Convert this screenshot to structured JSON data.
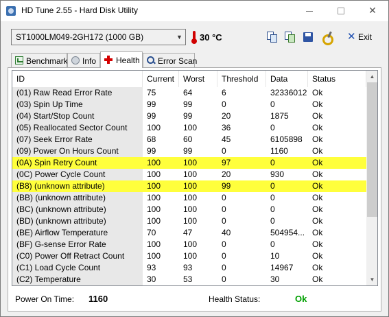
{
  "window": {
    "title": "HD Tune 2.55 - Hard Disk Utility"
  },
  "toolbar": {
    "drive": "ST1000LM049-2GH172 (1000 GB)",
    "temperature": "30 °C",
    "exit_label": "Exit"
  },
  "tabs": [
    {
      "label": "Benchmark",
      "icon": "benchmark-icon"
    },
    {
      "label": "Info",
      "icon": "info-icon"
    },
    {
      "label": "Health",
      "icon": "health-cross-icon",
      "selected": true
    },
    {
      "label": "Error Scan",
      "icon": "error-scan-icon"
    }
  ],
  "table": {
    "columns": [
      "ID",
      "Current",
      "Worst",
      "Threshold",
      "Data",
      "Status"
    ],
    "rows": [
      {
        "id": "(01) Raw Read Error Rate",
        "current": "75",
        "worst": "64",
        "threshold": "6",
        "data": "32336012",
        "status": "Ok",
        "highlight": false
      },
      {
        "id": "(03) Spin Up Time",
        "current": "99",
        "worst": "99",
        "threshold": "0",
        "data": "0",
        "status": "Ok",
        "highlight": false
      },
      {
        "id": "(04) Start/Stop Count",
        "current": "99",
        "worst": "99",
        "threshold": "20",
        "data": "1875",
        "status": "Ok",
        "highlight": false
      },
      {
        "id": "(05) Reallocated Sector Count",
        "current": "100",
        "worst": "100",
        "threshold": "36",
        "data": "0",
        "status": "Ok",
        "highlight": false
      },
      {
        "id": "(07) Seek Error Rate",
        "current": "68",
        "worst": "60",
        "threshold": "45",
        "data": "6105898",
        "status": "Ok",
        "highlight": false
      },
      {
        "id": "(09) Power On Hours Count",
        "current": "99",
        "worst": "99",
        "threshold": "0",
        "data": "1160",
        "status": "Ok",
        "highlight": false
      },
      {
        "id": "(0A) Spin Retry Count",
        "current": "100",
        "worst": "100",
        "threshold": "97",
        "data": "0",
        "status": "Ok",
        "highlight": true
      },
      {
        "id": "(0C) Power Cycle Count",
        "current": "100",
        "worst": "100",
        "threshold": "20",
        "data": "930",
        "status": "Ok",
        "highlight": false
      },
      {
        "id": "(B8) (unknown attribute)",
        "current": "100",
        "worst": "100",
        "threshold": "99",
        "data": "0",
        "status": "Ok",
        "highlight": true
      },
      {
        "id": "(BB) (unknown attribute)",
        "current": "100",
        "worst": "100",
        "threshold": "0",
        "data": "0",
        "status": "Ok",
        "highlight": false
      },
      {
        "id": "(BC) (unknown attribute)",
        "current": "100",
        "worst": "100",
        "threshold": "0",
        "data": "0",
        "status": "Ok",
        "highlight": false
      },
      {
        "id": "(BD) (unknown attribute)",
        "current": "100",
        "worst": "100",
        "threshold": "0",
        "data": "0",
        "status": "Ok",
        "highlight": false
      },
      {
        "id": "(BE) Airflow Temperature",
        "current": "70",
        "worst": "47",
        "threshold": "40",
        "data": "504954...",
        "status": "Ok",
        "highlight": false
      },
      {
        "id": "(BF) G-sense Error Rate",
        "current": "100",
        "worst": "100",
        "threshold": "0",
        "data": "0",
        "status": "Ok",
        "highlight": false
      },
      {
        "id": "(C0) Power Off Retract Count",
        "current": "100",
        "worst": "100",
        "threshold": "0",
        "data": "10",
        "status": "Ok",
        "highlight": false
      },
      {
        "id": "(C1) Load Cycle Count",
        "current": "93",
        "worst": "93",
        "threshold": "0",
        "data": "14967",
        "status": "Ok",
        "highlight": false
      },
      {
        "id": "(C2) Temperature",
        "current": "30",
        "worst": "53",
        "threshold": "0",
        "data": "30",
        "status": "Ok",
        "highlight": false
      }
    ]
  },
  "footer": {
    "power_on_time_label": "Power On Time:",
    "power_on_time_value": "1160",
    "health_status_label": "Health Status:",
    "health_status_value": "Ok"
  },
  "colors": {
    "highlight": "#ffff3c",
    "ok_status": "#00a000",
    "temperature": "#d00000"
  }
}
